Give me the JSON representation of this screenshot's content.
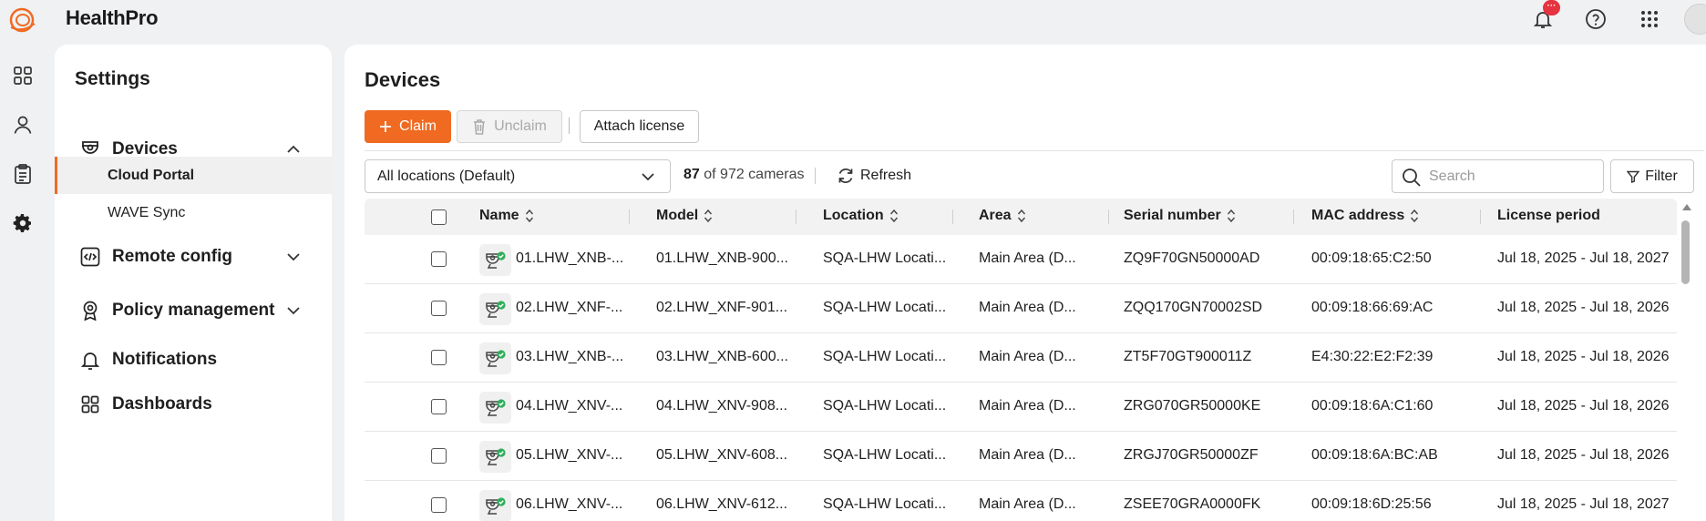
{
  "app": {
    "title": "HealthPro",
    "notification_badge": "···",
    "brand_color": "#f06a21"
  },
  "rail": {
    "items": [
      "dashboard-grid-icon",
      "user-icon",
      "clipboard-icon",
      "gear-icon"
    ]
  },
  "settings": {
    "title": "Settings",
    "sections": [
      {
        "label": "Devices",
        "icon": "camera-icon",
        "expanded": true
      },
      {
        "label": "Remote config",
        "icon": "code-icon",
        "expanded": false
      },
      {
        "label": "Policy management",
        "icon": "badge-icon",
        "expanded": false
      },
      {
        "label": "Notifications",
        "icon": "bell-icon"
      },
      {
        "label": "Dashboards",
        "icon": "grid-icon"
      }
    ],
    "sub_items": [
      {
        "label": "Cloud Portal",
        "active": true
      },
      {
        "label": "WAVE Sync",
        "active": false
      }
    ]
  },
  "main": {
    "title": "Devices",
    "buttons": {
      "claim": "Claim",
      "unclaim": "Unclaim",
      "attach": "Attach license"
    },
    "location_select": "All locations (Default)",
    "count_value": "87",
    "count_text": "of 972 cameras",
    "refresh": "Refresh",
    "search_placeholder": "Search",
    "filter": "Filter"
  },
  "table": {
    "columns": [
      "Name",
      "Model",
      "Location",
      "Area",
      "Serial number",
      "MAC address",
      "License period"
    ],
    "rows": [
      [
        "01.LHW_XNB-...",
        "01.LHW_XNB-900...",
        "SQA-LHW Locati...",
        "Main Area (D...",
        "ZQ9F70GN50000AD",
        "00:09:18:65:C2:50",
        "Jul 18, 2025 - Jul 18, 2027"
      ],
      [
        "02.LHW_XNF-...",
        "02.LHW_XNF-901...",
        "SQA-LHW Locati...",
        "Main Area (D...",
        "ZQQ170GN70002SD",
        "00:09:18:66:69:AC",
        "Jul 18, 2025 - Jul 18, 2026"
      ],
      [
        "03.LHW_XNB-...",
        "03.LHW_XNB-600...",
        "SQA-LHW Locati...",
        "Main Area (D...",
        "ZT5F70GT900011Z",
        "E4:30:22:E2:F2:39",
        "Jul 18, 2025 - Jul 18, 2026"
      ],
      [
        "04.LHW_XNV-...",
        "04.LHW_XNV-908...",
        "SQA-LHW Locati...",
        "Main Area (D...",
        "ZRG070GR50000KE",
        "00:09:18:6A:C1:60",
        "Jul 18, 2025 - Jul 18, 2026"
      ],
      [
        "05.LHW_XNV-...",
        "05.LHW_XNV-608...",
        "SQA-LHW Locati...",
        "Main Area (D...",
        "ZRGJ70GR50000ZF",
        "00:09:18:6A:BC:AB",
        "Jul 18, 2025 - Jul 18, 2026"
      ],
      [
        "06.LHW_XNV-...",
        "06.LHW_XNV-612...",
        "SQA-LHW Locati...",
        "Main Area (D...",
        "ZSEE70GRA0000FK",
        "00:09:18:6D:25:56",
        "Jul 18, 2025 - Jul 18, 2027"
      ]
    ]
  }
}
